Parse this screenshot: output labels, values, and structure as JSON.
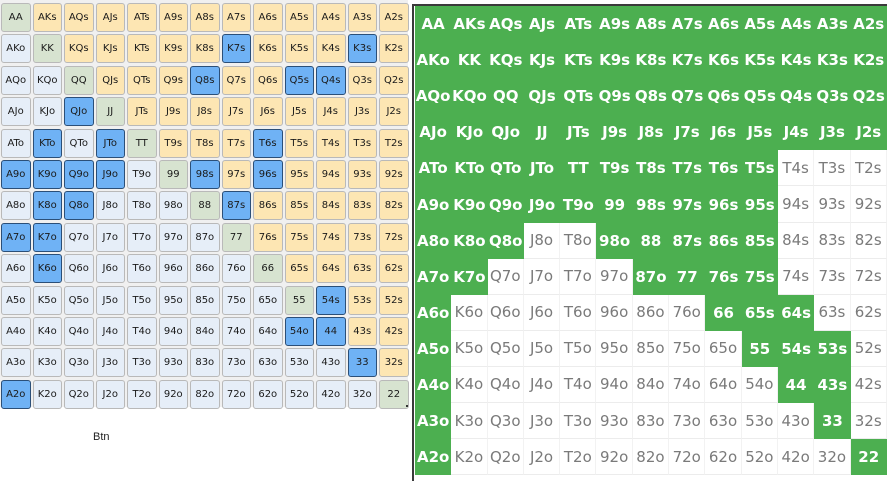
{
  "position_label": "Btn",
  "colors": {
    "pair": "#d7e3d0",
    "suited": "#fde6b3",
    "offsuit": "#e6eef8",
    "highlight": "#6fb2f5",
    "range_in": "#4caf50",
    "range_out": "#ffffff"
  },
  "hands": [
    [
      "AA",
      "AKs",
      "AQs",
      "AJs",
      "ATs",
      "A9s",
      "A8s",
      "A7s",
      "A6s",
      "A5s",
      "A4s",
      "A3s",
      "A2s"
    ],
    [
      "AKo",
      "KK",
      "KQs",
      "KJs",
      "KTs",
      "K9s",
      "K8s",
      "K7s",
      "K6s",
      "K5s",
      "K4s",
      "K3s",
      "K2s"
    ],
    [
      "AQo",
      "KQo",
      "QQ",
      "QJs",
      "QTs",
      "Q9s",
      "Q8s",
      "Q7s",
      "Q6s",
      "Q5s",
      "Q4s",
      "Q3s",
      "Q2s"
    ],
    [
      "AJo",
      "KJo",
      "QJo",
      "JJ",
      "JTs",
      "J9s",
      "J8s",
      "J7s",
      "J6s",
      "J5s",
      "J4s",
      "J3s",
      "J2s"
    ],
    [
      "ATo",
      "KTo",
      "QTo",
      "JTo",
      "TT",
      "T9s",
      "T8s",
      "T7s",
      "T6s",
      "T5s",
      "T4s",
      "T3s",
      "T2s"
    ],
    [
      "A9o",
      "K9o",
      "Q9o",
      "J9o",
      "T9o",
      "99",
      "98s",
      "97s",
      "96s",
      "95s",
      "94s",
      "93s",
      "92s"
    ],
    [
      "A8o",
      "K8o",
      "Q8o",
      "J8o",
      "T8o",
      "98o",
      "88",
      "87s",
      "86s",
      "85s",
      "84s",
      "83s",
      "82s"
    ],
    [
      "A7o",
      "K7o",
      "Q7o",
      "J7o",
      "T7o",
      "97o",
      "87o",
      "77",
      "76s",
      "75s",
      "74s",
      "73s",
      "72s"
    ],
    [
      "A6o",
      "K6o",
      "Q6o",
      "J6o",
      "T6o",
      "96o",
      "86o",
      "76o",
      "66",
      "65s",
      "64s",
      "63s",
      "62s"
    ],
    [
      "A5o",
      "K5o",
      "Q5o",
      "J5o",
      "T5o",
      "95o",
      "85o",
      "75o",
      "65o",
      "55",
      "54s",
      "53s",
      "52s"
    ],
    [
      "A4o",
      "K4o",
      "Q4o",
      "J4o",
      "T4o",
      "94o",
      "84o",
      "74o",
      "64o",
      "54o",
      "44",
      "43s",
      "42s"
    ],
    [
      "A3o",
      "K3o",
      "Q3o",
      "J3o",
      "T3o",
      "93o",
      "83o",
      "73o",
      "63o",
      "53o",
      "43o",
      "33",
      "32s"
    ],
    [
      "A2o",
      "K2o",
      "Q2o",
      "J2o",
      "T2o",
      "92o",
      "82o",
      "72o",
      "62o",
      "52o",
      "42o",
      "32o",
      "22"
    ]
  ],
  "left_highlighted": [
    "K7s",
    "K3s",
    "Q8s",
    "Q5s",
    "Q4s",
    "QJo",
    "KTo",
    "JTo",
    "T6s",
    "A9o",
    "K9o",
    "Q9o",
    "J9o",
    "98s",
    "96s",
    "K8o",
    "Q8o",
    "87s",
    "A7o",
    "K7o",
    "K6o",
    "54s",
    "54o",
    "44",
    "33",
    "A2o"
  ],
  "right_range": [
    "AA",
    "AKs",
    "AQs",
    "AJs",
    "ATs",
    "A9s",
    "A8s",
    "A7s",
    "A6s",
    "A5s",
    "A4s",
    "A3s",
    "A2s",
    "AKo",
    "KK",
    "KQs",
    "KJs",
    "KTs",
    "K9s",
    "K8s",
    "K7s",
    "K6s",
    "K5s",
    "K4s",
    "K3s",
    "K2s",
    "AQo",
    "KQo",
    "QQ",
    "QJs",
    "QTs",
    "Q9s",
    "Q8s",
    "Q7s",
    "Q6s",
    "Q5s",
    "Q4s",
    "Q3s",
    "Q2s",
    "AJo",
    "KJo",
    "QJo",
    "JJ",
    "JTs",
    "J9s",
    "J8s",
    "J7s",
    "J6s",
    "J5s",
    "J4s",
    "J3s",
    "J2s",
    "ATo",
    "KTo",
    "QTo",
    "JTo",
    "TT",
    "T9s",
    "T8s",
    "T7s",
    "T6s",
    "T5s",
    "A9o",
    "K9o",
    "Q9o",
    "J9o",
    "T9o",
    "99",
    "98s",
    "97s",
    "96s",
    "95s",
    "A8o",
    "K8o",
    "Q8o",
    "98o",
    "88",
    "87s",
    "86s",
    "85s",
    "A7o",
    "K7o",
    "87o",
    "77",
    "76s",
    "75s",
    "A6o",
    "66",
    "65s",
    "64s",
    "A5o",
    "55",
    "54s",
    "53s",
    "A4o",
    "44",
    "43s",
    "A3o",
    "33",
    "A2o",
    "22"
  ]
}
